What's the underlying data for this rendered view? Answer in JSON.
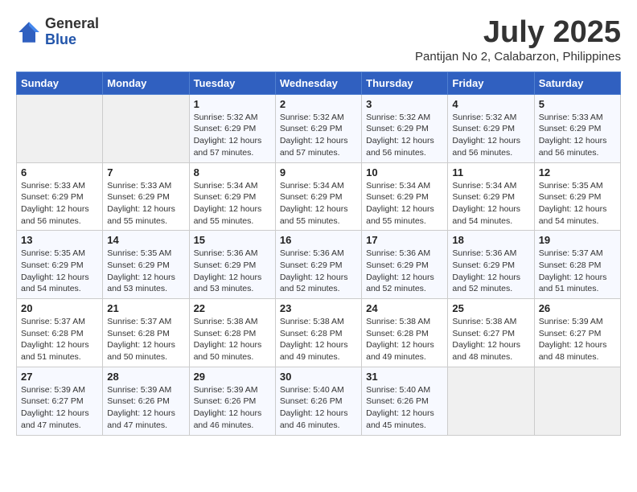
{
  "header": {
    "logo_general": "General",
    "logo_blue": "Blue",
    "month_title": "July 2025",
    "location": "Pantijan No 2, Calabarzon, Philippines"
  },
  "days_of_week": [
    "Sunday",
    "Monday",
    "Tuesday",
    "Wednesday",
    "Thursday",
    "Friday",
    "Saturday"
  ],
  "weeks": [
    [
      {
        "day": "",
        "info": ""
      },
      {
        "day": "",
        "info": ""
      },
      {
        "day": "1",
        "info": "Sunrise: 5:32 AM\nSunset: 6:29 PM\nDaylight: 12 hours and 57 minutes."
      },
      {
        "day": "2",
        "info": "Sunrise: 5:32 AM\nSunset: 6:29 PM\nDaylight: 12 hours and 57 minutes."
      },
      {
        "day": "3",
        "info": "Sunrise: 5:32 AM\nSunset: 6:29 PM\nDaylight: 12 hours and 56 minutes."
      },
      {
        "day": "4",
        "info": "Sunrise: 5:32 AM\nSunset: 6:29 PM\nDaylight: 12 hours and 56 minutes."
      },
      {
        "day": "5",
        "info": "Sunrise: 5:33 AM\nSunset: 6:29 PM\nDaylight: 12 hours and 56 minutes."
      }
    ],
    [
      {
        "day": "6",
        "info": "Sunrise: 5:33 AM\nSunset: 6:29 PM\nDaylight: 12 hours and 56 minutes."
      },
      {
        "day": "7",
        "info": "Sunrise: 5:33 AM\nSunset: 6:29 PM\nDaylight: 12 hours and 55 minutes."
      },
      {
        "day": "8",
        "info": "Sunrise: 5:34 AM\nSunset: 6:29 PM\nDaylight: 12 hours and 55 minutes."
      },
      {
        "day": "9",
        "info": "Sunrise: 5:34 AM\nSunset: 6:29 PM\nDaylight: 12 hours and 55 minutes."
      },
      {
        "day": "10",
        "info": "Sunrise: 5:34 AM\nSunset: 6:29 PM\nDaylight: 12 hours and 55 minutes."
      },
      {
        "day": "11",
        "info": "Sunrise: 5:34 AM\nSunset: 6:29 PM\nDaylight: 12 hours and 54 minutes."
      },
      {
        "day": "12",
        "info": "Sunrise: 5:35 AM\nSunset: 6:29 PM\nDaylight: 12 hours and 54 minutes."
      }
    ],
    [
      {
        "day": "13",
        "info": "Sunrise: 5:35 AM\nSunset: 6:29 PM\nDaylight: 12 hours and 54 minutes."
      },
      {
        "day": "14",
        "info": "Sunrise: 5:35 AM\nSunset: 6:29 PM\nDaylight: 12 hours and 53 minutes."
      },
      {
        "day": "15",
        "info": "Sunrise: 5:36 AM\nSunset: 6:29 PM\nDaylight: 12 hours and 53 minutes."
      },
      {
        "day": "16",
        "info": "Sunrise: 5:36 AM\nSunset: 6:29 PM\nDaylight: 12 hours and 52 minutes."
      },
      {
        "day": "17",
        "info": "Sunrise: 5:36 AM\nSunset: 6:29 PM\nDaylight: 12 hours and 52 minutes."
      },
      {
        "day": "18",
        "info": "Sunrise: 5:36 AM\nSunset: 6:29 PM\nDaylight: 12 hours and 52 minutes."
      },
      {
        "day": "19",
        "info": "Sunrise: 5:37 AM\nSunset: 6:28 PM\nDaylight: 12 hours and 51 minutes."
      }
    ],
    [
      {
        "day": "20",
        "info": "Sunrise: 5:37 AM\nSunset: 6:28 PM\nDaylight: 12 hours and 51 minutes."
      },
      {
        "day": "21",
        "info": "Sunrise: 5:37 AM\nSunset: 6:28 PM\nDaylight: 12 hours and 50 minutes."
      },
      {
        "day": "22",
        "info": "Sunrise: 5:38 AM\nSunset: 6:28 PM\nDaylight: 12 hours and 50 minutes."
      },
      {
        "day": "23",
        "info": "Sunrise: 5:38 AM\nSunset: 6:28 PM\nDaylight: 12 hours and 49 minutes."
      },
      {
        "day": "24",
        "info": "Sunrise: 5:38 AM\nSunset: 6:28 PM\nDaylight: 12 hours and 49 minutes."
      },
      {
        "day": "25",
        "info": "Sunrise: 5:38 AM\nSunset: 6:27 PM\nDaylight: 12 hours and 48 minutes."
      },
      {
        "day": "26",
        "info": "Sunrise: 5:39 AM\nSunset: 6:27 PM\nDaylight: 12 hours and 48 minutes."
      }
    ],
    [
      {
        "day": "27",
        "info": "Sunrise: 5:39 AM\nSunset: 6:27 PM\nDaylight: 12 hours and 47 minutes."
      },
      {
        "day": "28",
        "info": "Sunrise: 5:39 AM\nSunset: 6:26 PM\nDaylight: 12 hours and 47 minutes."
      },
      {
        "day": "29",
        "info": "Sunrise: 5:39 AM\nSunset: 6:26 PM\nDaylight: 12 hours and 46 minutes."
      },
      {
        "day": "30",
        "info": "Sunrise: 5:40 AM\nSunset: 6:26 PM\nDaylight: 12 hours and 46 minutes."
      },
      {
        "day": "31",
        "info": "Sunrise: 5:40 AM\nSunset: 6:26 PM\nDaylight: 12 hours and 45 minutes."
      },
      {
        "day": "",
        "info": ""
      },
      {
        "day": "",
        "info": ""
      }
    ]
  ]
}
